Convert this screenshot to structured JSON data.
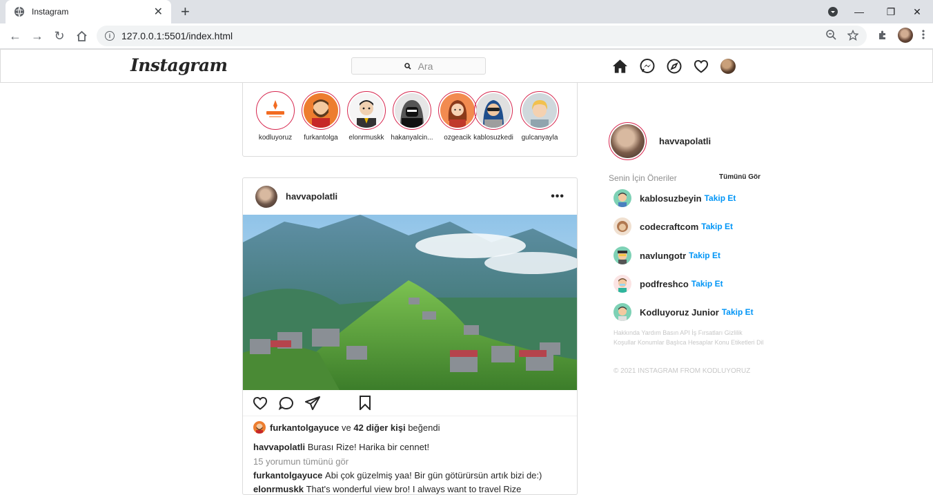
{
  "browser": {
    "tab_title": "Instagram",
    "url": "127.0.0.1:5501/index.html"
  },
  "header": {
    "logo": "Instagram",
    "search_placeholder": "Ara"
  },
  "stories": [
    {
      "name": "kodluyoruz",
      "icon": "kodluyoruz-logo"
    },
    {
      "name": "furkantolga",
      "icon": "avatar-beard"
    },
    {
      "name": "elonrmuskk",
      "icon": "avatar-suit"
    },
    {
      "name": "hakanyalcin...",
      "icon": "avatar-hood"
    },
    {
      "name": "ozgeacik",
      "icon": "avatar-woman"
    },
    {
      "name": "kablosuzkedi",
      "icon": "avatar-hacker"
    },
    {
      "name": "gulcanyayla",
      "icon": "avatar-blonde"
    }
  ],
  "post": {
    "username": "havvapolatli",
    "liked_by_user": "furkantolgayuce",
    "liked_by_connector": "ve",
    "liked_by_others": "42 diğer kişi",
    "liked_suffix": "beğendi",
    "caption_user": "havvapolatli",
    "caption_text": "Burası Rize! Harika bir cennet!",
    "comments_link": "15 yorumun tümünü gör",
    "comments": [
      {
        "user": "furkantolgayuce",
        "text": "Abi çok güzelmiş yaa! Bir gün götürürsün artık bizi de:)"
      },
      {
        "user": "elonrmuskk",
        "text": "That's wonderful view bro! I always want to travel Rize"
      }
    ]
  },
  "sidebar": {
    "profile_name": "havvapolatli",
    "suggestions_title": "Senin İçin Öneriler",
    "see_all": "Tümünü Gör",
    "follow_label": "Takip Et",
    "suggestions": [
      {
        "name": "kablosuzbeyin"
      },
      {
        "name": "codecraftcom"
      },
      {
        "name": "navlungotr"
      },
      {
        "name": "podfreshco"
      },
      {
        "name": "Kodluyoruz Junior"
      }
    ],
    "footer_links": "Hakkında Yardım Basın API İş Fırsatları Gizlilik Koşullar Konumlar Başlıca Hesaplar Konu Etiketleri Dil",
    "copyright": "© 2021 INSTAGRAM FROM KODLUYORUZ"
  },
  "colors": {
    "story_ring": "#d6244c",
    "link_blue": "#0095f6"
  }
}
